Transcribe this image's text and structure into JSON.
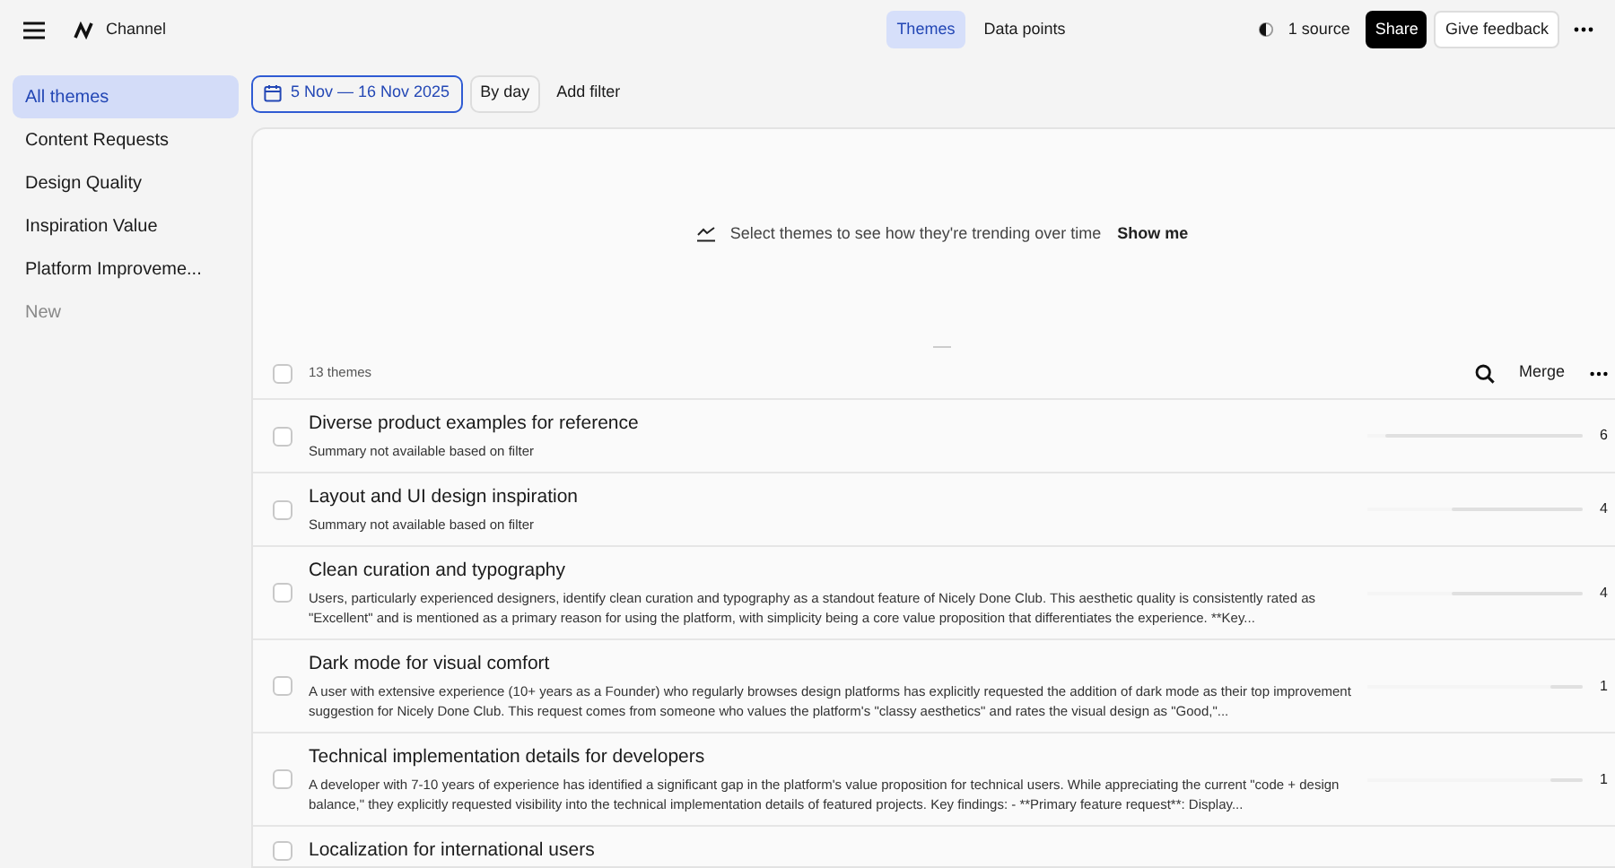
{
  "header": {
    "title": "Channel",
    "tabs": [
      {
        "label": "Themes",
        "selected": true
      },
      {
        "label": "Data points",
        "selected": false
      }
    ],
    "source": "1 source",
    "share": "Share",
    "feedback": "Give feedback"
  },
  "sidebar": {
    "items": [
      {
        "label": "All themes",
        "selected": true
      },
      {
        "label": "Content Requests",
        "selected": false
      },
      {
        "label": "Design Quality",
        "selected": false
      },
      {
        "label": "Inspiration Value",
        "selected": false
      },
      {
        "label": "Platform Improveme...",
        "selected": false
      }
    ],
    "new": "New"
  },
  "filters": {
    "date_range": "5 Nov — 16 Nov 2025",
    "group": "By day",
    "add": "Add filter"
  },
  "trend": {
    "message": "Select themes to see how they're trending over time",
    "action": "Show me"
  },
  "list": {
    "all_checked": false,
    "count": "13 themes",
    "merge": "Merge",
    "rows": [
      {
        "title": "Diverse product examples for reference",
        "summary": "Summary not available based on filter",
        "level": 0.92,
        "count": "6",
        "checked": false
      },
      {
        "title": "Layout and UI design inspiration",
        "summary": "Summary not available based on filter",
        "level": 0.61,
        "count": "4",
        "checked": false
      },
      {
        "title": "Clean curation and typography",
        "summary": "Users, particularly experienced designers, identify clean curation and typography as a standout feature of Nicely Done Club. This aesthetic quality is consistently rated as \"Excellent\" and is mentioned as a primary reason for using the platform, with simplicity being a core value proposition that differentiates the experience. **Key...",
        "level": 0.61,
        "count": "4",
        "checked": false
      },
      {
        "title": "Dark mode for visual comfort",
        "summary": "A user with extensive experience (10+ years as a Founder) who regularly browses design platforms has explicitly requested the addition of dark mode as their top improvement suggestion for Nicely Done Club. This request comes from someone who values the platform's \"classy aesthetics\" and rates the visual design as \"Good,\"...",
        "level": 0.15,
        "count": "1",
        "checked": false
      },
      {
        "title": "Technical implementation details for developers",
        "summary": "A developer with 7-10 years of experience has identified a significant gap in the platform's value proposition for technical users. While appreciating the current \"code + design balance,\" they explicitly requested visibility into the technical implementation details of featured projects. Key findings: - **Primary feature request**: Display...",
        "level": 0.15,
        "count": "1",
        "checked": false
      },
      {
        "title": "Localization for international users",
        "level": null,
        "checked": false
      }
    ]
  }
}
